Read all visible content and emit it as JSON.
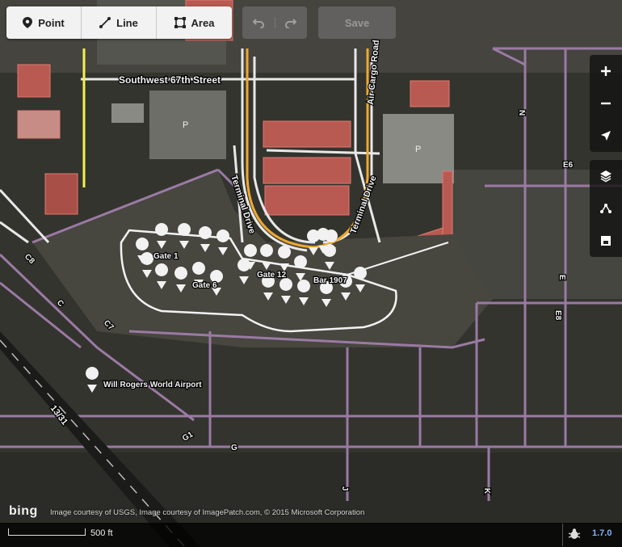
{
  "toolbar": {
    "point_label": "Point",
    "line_label": "Line",
    "area_label": "Area",
    "save_label": "Save"
  },
  "map_labels": {
    "southwest_67th": "Southwest 67th Street",
    "air_cargo_road": "Air Cargo Road",
    "terminal_drive_left": "Terminal Drive",
    "terminal_drive_right": "Terminal Drive",
    "gate_1": "Gate 1",
    "gate_6": "Gate 6",
    "gate_12": "Gate 12",
    "bar_1907": "Bar 1907",
    "airport_name": "Will Rogers World Airport",
    "runway": "13/31",
    "taxiway_n": "N",
    "taxiway_e6": "E6",
    "taxiway_e": "E",
    "taxiway_e8": "E8",
    "taxiway_c8": "C8",
    "taxiway_c": "C",
    "taxiway_c7": "C7",
    "taxiway_g1": "G1",
    "taxiway_g": "G",
    "taxiway_j": "J",
    "taxiway_k": "K",
    "parking_p1": "P",
    "parking_p2": "P"
  },
  "footer": {
    "bing_logo": "bing",
    "attribution": "Image courtesy of USGS, Image courtesy of ImagePatch.com, © 2015 Microsoft Corporation",
    "scale": "500 ft",
    "version": "1.7.0"
  },
  "icons": [
    "point-icon",
    "line-icon",
    "area-icon",
    "undo-icon",
    "redo-icon",
    "zoom-in-icon",
    "zoom-out-icon",
    "locate-icon",
    "layers-icon",
    "map-data-icon",
    "help-icon",
    "bug-icon"
  ],
  "colors": {
    "taxiway": "#9a7aa4",
    "road_yellow": "#f0a830",
    "highlight_yellow": "#f4f050",
    "building_red": "#c8635a",
    "toolbar_bg": "#f2f2f2",
    "version_blue": "#7fb0ff"
  }
}
